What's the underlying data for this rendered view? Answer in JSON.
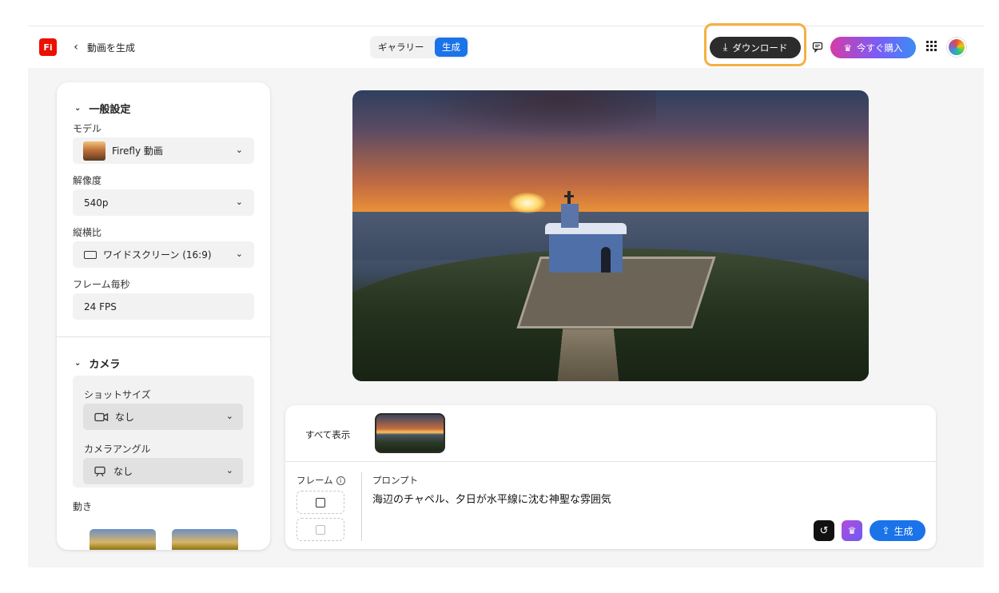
{
  "header": {
    "logo_text": "Fi",
    "back_icon": "chevron-left-icon",
    "title": "動画を生成",
    "tabs": [
      {
        "label": "ギャラリー",
        "active": false
      },
      {
        "label": "生成",
        "active": true
      }
    ],
    "download_label": "ダウンロード",
    "download_icon": "download-icon",
    "feedback_icon": "feedback-icon",
    "buy_label": "今すぐ購入",
    "buy_icon": "crown-icon",
    "apps_icon": "apps-grid-icon",
    "avatar_icon": "user-avatar"
  },
  "sidebar": {
    "general": {
      "heading": "一般設定",
      "model_label": "モデル",
      "model_value": "Firefly 動画",
      "resolution_label": "解像度",
      "resolution_value": "540p",
      "aspect_label": "縦横比",
      "aspect_value": "ワイドスクリーン (16:9)",
      "fps_label": "フレーム毎秒",
      "fps_value": "24 FPS"
    },
    "camera": {
      "heading": "カメラ",
      "shot_size_label": "ショットサイズ",
      "shot_size_value": "なし",
      "angle_label": "カメラアングル",
      "angle_value": "なし",
      "motion_label": "動き"
    }
  },
  "prompt_panel": {
    "show_all_label": "すべて表示",
    "frame_label": "フレーム",
    "prompt_label": "プロンプト",
    "prompt_text": "海辺のチャペル、夕日が水平線に沈む神聖な雰囲気",
    "generate_label": "生成"
  },
  "colors": {
    "accent": "#1a73e8",
    "download_highlight": "#f5b042",
    "logo_bg": "#eb1000"
  }
}
